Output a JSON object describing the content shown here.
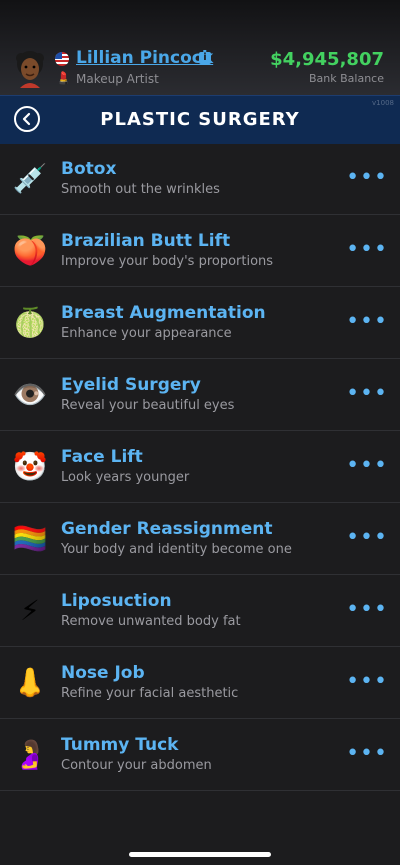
{
  "profile": {
    "name": "Lillian Pincock",
    "job": "Makeup Artist",
    "balance": "$4,945,807",
    "balance_label": "Bank Balance"
  },
  "header": {
    "title": "PLASTIC SURGERY",
    "tag": "v1008"
  },
  "items": [
    {
      "title": "Botox",
      "subtitle": "Smooth out the wrinkles",
      "icon": "💉",
      "icon_name": "syringe-icon"
    },
    {
      "title": "Brazilian Butt Lift",
      "subtitle": "Improve your body's proportions",
      "icon": "🍑",
      "icon_name": "peach-icon"
    },
    {
      "title": "Breast Augmentation",
      "subtitle": "Enhance your appearance",
      "icon": "🍈",
      "icon_name": "melon-icon"
    },
    {
      "title": "Eyelid Surgery",
      "subtitle": "Reveal your beautiful eyes",
      "icon": "👁️",
      "icon_name": "eye-icon"
    },
    {
      "title": "Face Lift",
      "subtitle": "Look years younger",
      "icon": "🤡",
      "icon_name": "clown-face-icon"
    },
    {
      "title": "Gender Reassignment",
      "subtitle": "Your body and identity become one",
      "icon": "🏳️‍🌈",
      "icon_name": "rainbow-flag-icon"
    },
    {
      "title": "Liposuction",
      "subtitle": "Remove unwanted body fat",
      "icon": "⚡",
      "icon_name": "lightning-icon"
    },
    {
      "title": "Nose Job",
      "subtitle": "Refine your facial aesthetic",
      "icon": "👃",
      "icon_name": "nose-icon"
    },
    {
      "title": "Tummy Tuck",
      "subtitle": "Contour your abdomen",
      "icon": "🤰",
      "icon_name": "pregnant-woman-icon"
    }
  ],
  "more_label": "•••",
  "colors": {
    "accent": "#5cb4f2",
    "balance": "#43d160",
    "header_bg": "#0f2a52",
    "background": "#1c1c1e"
  }
}
